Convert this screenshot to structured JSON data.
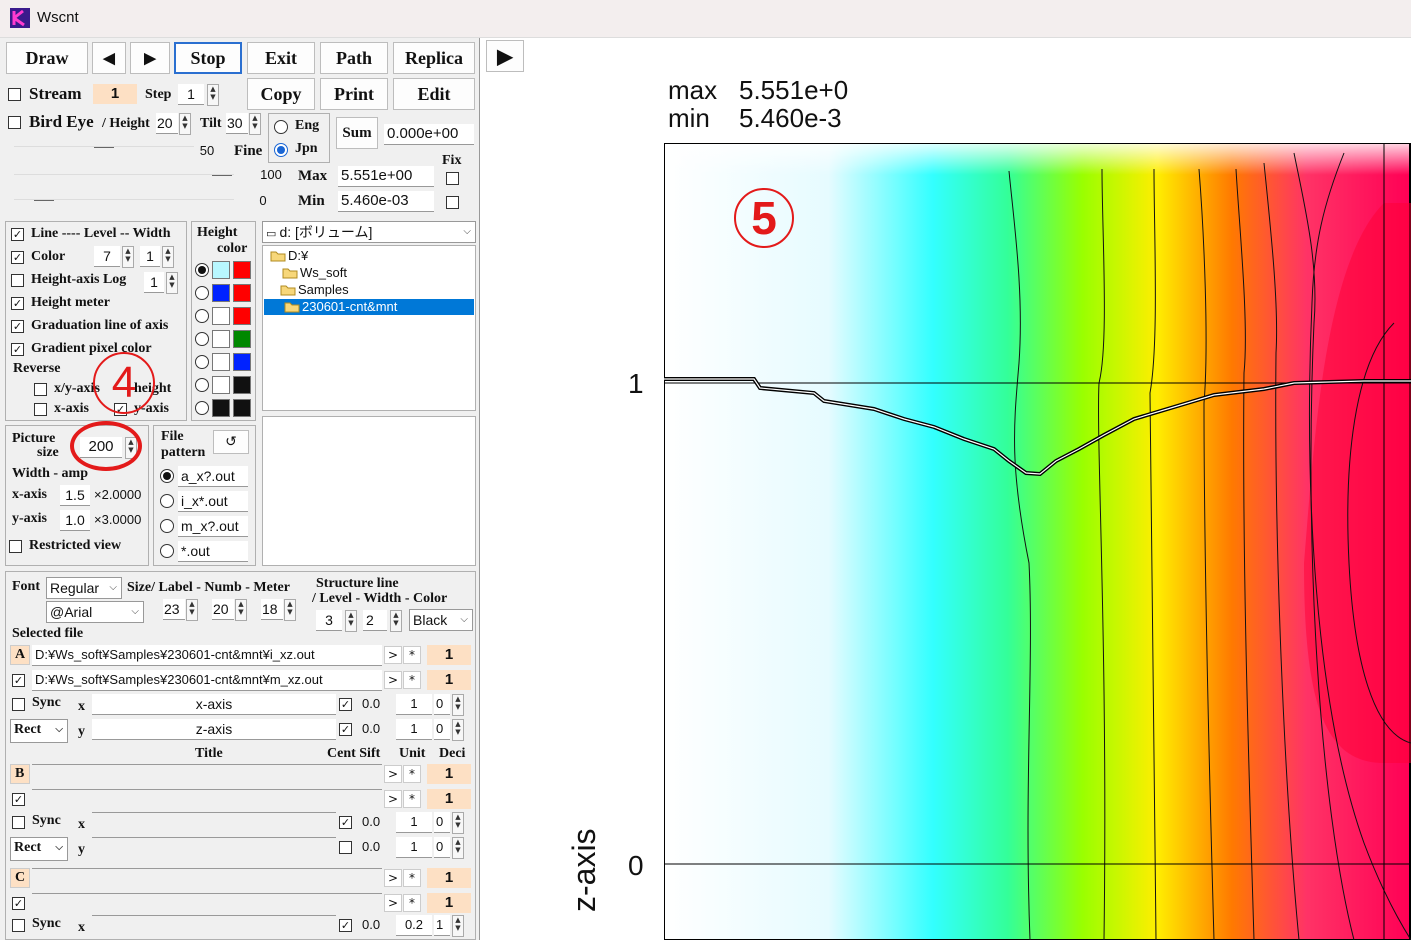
{
  "window": {
    "title": "Wscnt"
  },
  "toolbar": {
    "draw": "Draw",
    "prev": "◀",
    "next": "▶",
    "stop": "Stop",
    "exit": "Exit",
    "path": "Path",
    "replica": "Replica",
    "copy": "Copy",
    "print": "Print",
    "edit": "Edit",
    "play": "▶"
  },
  "stream": {
    "label": "Stream",
    "value": "1",
    "step_label": "Step",
    "step_value": "1"
  },
  "bird": {
    "label": "Bird Eye",
    "height_label": "/ Height",
    "height_value": "20",
    "tilt_label": "Tilt",
    "tilt_value": "30",
    "fifty": "50",
    "fine": "Fine"
  },
  "lang": {
    "eng": "Eng",
    "jpn": "Jpn"
  },
  "sum": {
    "label": "Sum",
    "value": "0.000e+00"
  },
  "fix": {
    "label": "Fix",
    "max_label": "Max",
    "max_value": "5.551e+00",
    "max_num": "100",
    "min_label": "Min",
    "min_value": "5.460e-03",
    "min_num": "0"
  },
  "lines": {
    "line_label": "Line ---- Level -- Width",
    "color": "Color",
    "level": "7",
    "width": "1",
    "height_log": "Height-axis Log",
    "log_val": "1",
    "meter": "Height meter",
    "grad": "Graduation line of axis",
    "gradient": "Gradient pixel color",
    "reverse": "Reverse",
    "xy": "x/y-axis",
    "height": "height",
    "xaxis": "x-axis",
    "yaxis": "y-axis"
  },
  "hc": {
    "title1": "Height",
    "title2": "color"
  },
  "drive": {
    "label": "d: [ボリューム]"
  },
  "tree": [
    "D:¥",
    "Ws_soft",
    "Samples",
    "230601-cnt&mnt"
  ],
  "picture": {
    "l1": "Picture",
    "l2": "size",
    "value": "200",
    "wa": "Width - amp",
    "xaxis": "x-axis",
    "x_amp": "1.5",
    "x_mul": "×2.0000",
    "yaxis": "y-axis",
    "y_amp": "1.0",
    "y_mul": "×3.0000",
    "restricted": "Restricted view"
  },
  "pattern": {
    "l1": "File",
    "l2": "pattern",
    "refresh": "↺",
    "opts": [
      "a_x?.out",
      "i_x*.out",
      "m_x?.out",
      "*.out"
    ]
  },
  "font": {
    "label": "Font",
    "style": "Regular",
    "face": "@Arial",
    "sizes_label": "Size/ Label - Numb - Meter",
    "s1": "23",
    "s2": "20",
    "s3": "18"
  },
  "structure": {
    "l1": "Structure line",
    "l2": "/ Level - Width - Color",
    "level": "3",
    "width": "2",
    "color": "Black"
  },
  "selected": {
    "label": "Selected file",
    "a_tag": "A",
    "file1": "D:¥Ws_soft¥Samples¥230601-cnt&mnt¥i_xz.out",
    "file2": "D:¥Ws_soft¥Samples¥230601-cnt&mnt¥m_xz.out",
    "gt": ">",
    "star": "*",
    "one": "1",
    "sync": "Sync",
    "x": "x",
    "y": "y",
    "rect": "Rect",
    "xaxis": "x-axis",
    "zaxis": "z-axis",
    "zero": "0.0",
    "unit": "1",
    "deci": "0"
  },
  "headers": {
    "title": "Title",
    "cent": "Cent Sift",
    "unit": "Unit",
    "deci": "Deci"
  },
  "groupB": {
    "tag": "B",
    "zero": "0.0",
    "unit": "1",
    "deci": "0"
  },
  "groupC": {
    "tag": "C",
    "zero": "0.0",
    "unit": "0.2",
    "deci": "1"
  },
  "annotations": {
    "four": "4",
    "five": "5"
  },
  "plot": {
    "max_label": "max",
    "max_value": "5.551e+0",
    "min_label": "min",
    "min_value": "5.460e-3",
    "ylabel": "z-axis",
    "tick1": "1",
    "tick0": "0"
  },
  "colors": {
    "accent": "#0078d7",
    "annot": "#e31a1a",
    "orange": "#fde0c4"
  }
}
